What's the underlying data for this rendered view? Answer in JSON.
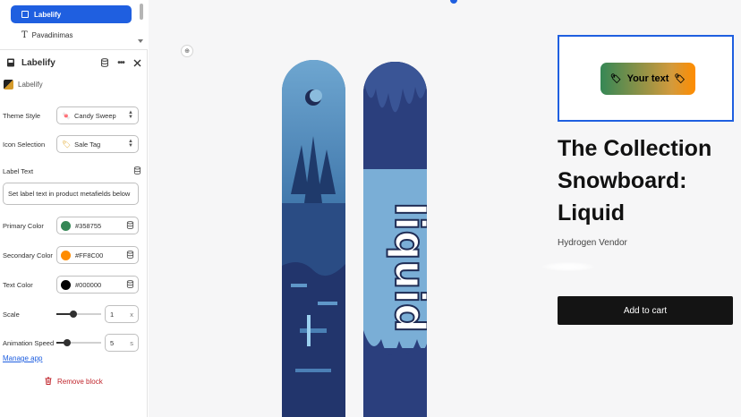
{
  "sidebar": {
    "tree": {
      "selected_label": "Labelify",
      "sub_label": "Pavadinimas"
    },
    "panel": {
      "title": "Labelify",
      "app_name": "Labelify"
    },
    "fields": {
      "theme_style": {
        "label": "Theme Style",
        "value": "Candy Sweep"
      },
      "icon_selection": {
        "label": "Icon Selection",
        "value": "Sale Tag"
      },
      "label_text": {
        "label": "Label Text",
        "value": "Set label text in product metafields below"
      },
      "primary_color": {
        "label": "Primary Color",
        "value": "#358755",
        "color": "#358755"
      },
      "secondary_color": {
        "label": "Secondary Color",
        "value": "#FF8C00",
        "color": "#FF8C00"
      },
      "text_color": {
        "label": "Text Color",
        "value": "#000000",
        "color": "#000000"
      },
      "scale": {
        "label": "Scale",
        "value": "1",
        "unit": "x",
        "level": 0.35
      },
      "animation_speed": {
        "label": "Animation Speed",
        "value": "5",
        "unit": "s",
        "level": 0.2
      }
    },
    "manage_link": "Manage app",
    "remove_label": "Remove block"
  },
  "preview": {
    "label_text": "Your text",
    "product_title": "The Collection Snowboard: Liquid",
    "vendor": "Hydrogen Vendor",
    "cart_button": "Add to cart",
    "board_art_text": "liquid"
  },
  "colors": {
    "accent": "#1f5fe0",
    "label_primary": "#358755",
    "label_secondary": "#FF8C00",
    "cart_bg": "#141414",
    "remove": "#c0262d"
  }
}
